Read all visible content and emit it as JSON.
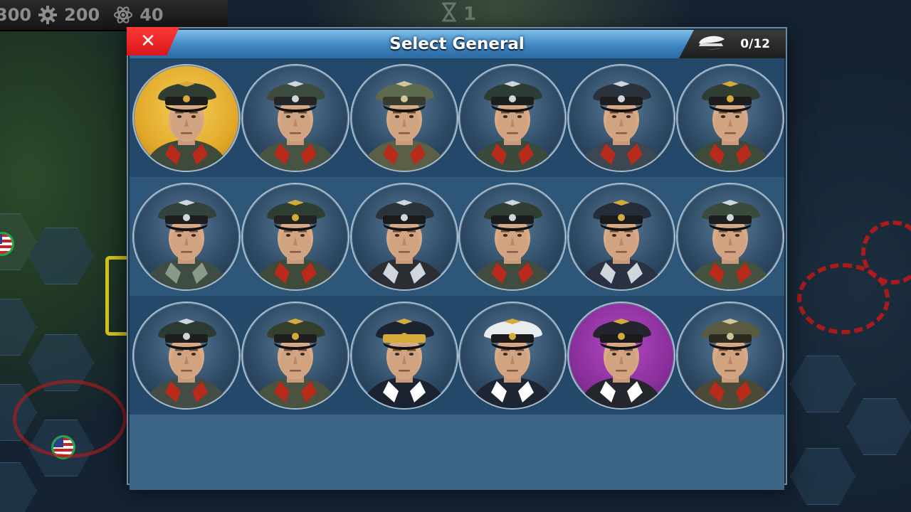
{
  "resources": [
    {
      "name": "gear",
      "value": "200",
      "icon": "gear-icon"
    },
    {
      "name": "atom",
      "value": "40",
      "icon": "atom-icon"
    }
  ],
  "resource_partial": {
    "value": "300"
  },
  "turn": {
    "value": "1",
    "icon": "hourglass-icon"
  },
  "dialog": {
    "title": "Select General",
    "close_label": "✕",
    "general_count": "0/12",
    "count_icon": "officer-cap-icon"
  },
  "generals": [
    {
      "highlight": "gold",
      "cap": "#2f3d33",
      "band": "#1c1c1c",
      "insignia": "#d4aa3a",
      "uniform": "#3e4a3a",
      "collar": "#b82a1a"
    },
    {
      "highlight": "none",
      "cap": "#3d4a3e",
      "band": "#252525",
      "insignia": "#cfd6dc",
      "uniform": "#485443",
      "collar": "#b82a1a"
    },
    {
      "highlight": "none",
      "cap": "#5e6a4e",
      "band": "#3a3a2a",
      "insignia": "#cfc49a",
      "uniform": "#5a5f46",
      "collar": "#b82a1a"
    },
    {
      "highlight": "none",
      "cap": "#2d3c35",
      "band": "#1e1e1e",
      "insignia": "#cfd6dc",
      "uniform": "#3b4a3d",
      "collar": "#b82a1a"
    },
    {
      "highlight": "none",
      "cap": "#2a333d",
      "band": "#1e1e1e",
      "insignia": "#cfd6dc",
      "uniform": "#3d4751",
      "collar": "#b82a1a"
    },
    {
      "highlight": "none",
      "cap": "#2f3d33",
      "band": "#1c1c1c",
      "insignia": "#d4aa3a",
      "uniform": "#3e4a3a",
      "collar": "#b82a1a"
    },
    {
      "highlight": "none",
      "cap": "#34423c",
      "band": "#1e1e1e",
      "insignia": "#cfd6dc",
      "uniform": "#3f4c44",
      "collar": "#8a9a8a"
    },
    {
      "highlight": "none",
      "cap": "#2e3f32",
      "band": "#222",
      "insignia": "#d4aa3a",
      "uniform": "#3e4a3a",
      "collar": "#b82a1a"
    },
    {
      "highlight": "none",
      "cap": "#2b3238",
      "band": "#1a1a1a",
      "insignia": "#cfd6dc",
      "uniform": "#2b2f33",
      "collar": "#cfd6dc"
    },
    {
      "highlight": "none",
      "cap": "#2f3d33",
      "band": "#1c1c1c",
      "insignia": "#cfd6dc",
      "uniform": "#404c3f",
      "collar": "#b82a1a"
    },
    {
      "highlight": "none",
      "cap": "#252c3a",
      "band": "#1a1a1a",
      "insignia": "#d4aa3a",
      "uniform": "#2a3140",
      "collar": "#cfd6dc"
    },
    {
      "highlight": "none",
      "cap": "#3a4a3c",
      "band": "#1e1e1e",
      "insignia": "#cfd6dc",
      "uniform": "#45523f",
      "collar": "#b82a1a"
    },
    {
      "highlight": "none",
      "cap": "#2c3a33",
      "band": "#1e1e1e",
      "insignia": "#cfd6dc",
      "uniform": "#434d45",
      "collar": "#b82a1a"
    },
    {
      "highlight": "none",
      "cap": "#34402c",
      "band": "#1e1e1e",
      "insignia": "#d4aa3a",
      "uniform": "#4a5240",
      "collar": "#b82a1a"
    },
    {
      "highlight": "none",
      "cap": "#1c2330",
      "band": "#d4aa3a",
      "insignia": "#d4aa3a",
      "uniform": "#1c2330",
      "collar": "#ffffff"
    },
    {
      "highlight": "none",
      "cap": "#e8ecef",
      "band": "#1a1a1a",
      "insignia": "#d4aa3a",
      "uniform": "#1e2633",
      "collar": "#ffffff"
    },
    {
      "highlight": "purple",
      "cap": "#22262c",
      "band": "#1a1a1a",
      "insignia": "#d4aa3a",
      "uniform": "#23272d",
      "collar": "#ffffff"
    },
    {
      "highlight": "none",
      "cap": "#5a5a3e",
      "band": "#2a2a1e",
      "insignia": "#cfc49a",
      "uniform": "#4a4a36",
      "collar": "#b82a1a"
    }
  ],
  "colors": {
    "header_blue": "#3f86c2",
    "close_red": "#d8151a",
    "panel": "#3c6588",
    "row_dark": "#24486a",
    "row_light": "#2e5679"
  }
}
